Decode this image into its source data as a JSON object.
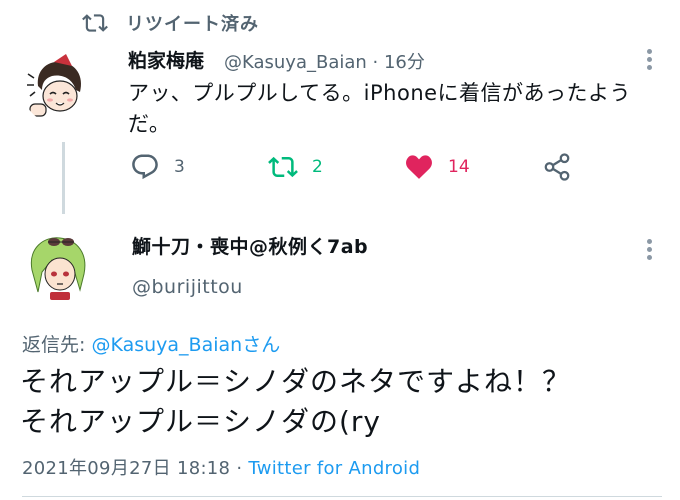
{
  "retweet_header": {
    "text": "リツイート済み",
    "icon": "retweet-icon"
  },
  "tweet": {
    "author_name": "粕家梅庵",
    "handle_time": "@Kasuya_Baian · 16分",
    "text": "アッ、プルプルしてる。iPhoneに着信があったようだ。",
    "actions": {
      "reply_count": "3",
      "retweet_count": "2",
      "like_count": "14"
    }
  },
  "reply": {
    "author_name": "鰤十刀・喪中@秋例く7ab",
    "handle": "@burijittou",
    "reply_to_prefix": "返信先: ",
    "reply_to_link": "@Kasuya_Baianさん",
    "text_line1": "それアップル＝シノダのネタですよね！？",
    "text_line2": "それアップル＝シノダの(ry",
    "timestamp": "2021年09月27日 18:18 · ",
    "source": "Twitter for Android"
  },
  "colors": {
    "accent": "#1d9bf0",
    "retweet_green": "#00ba7c",
    "like_red": "#f91880",
    "muted": "#536471"
  }
}
